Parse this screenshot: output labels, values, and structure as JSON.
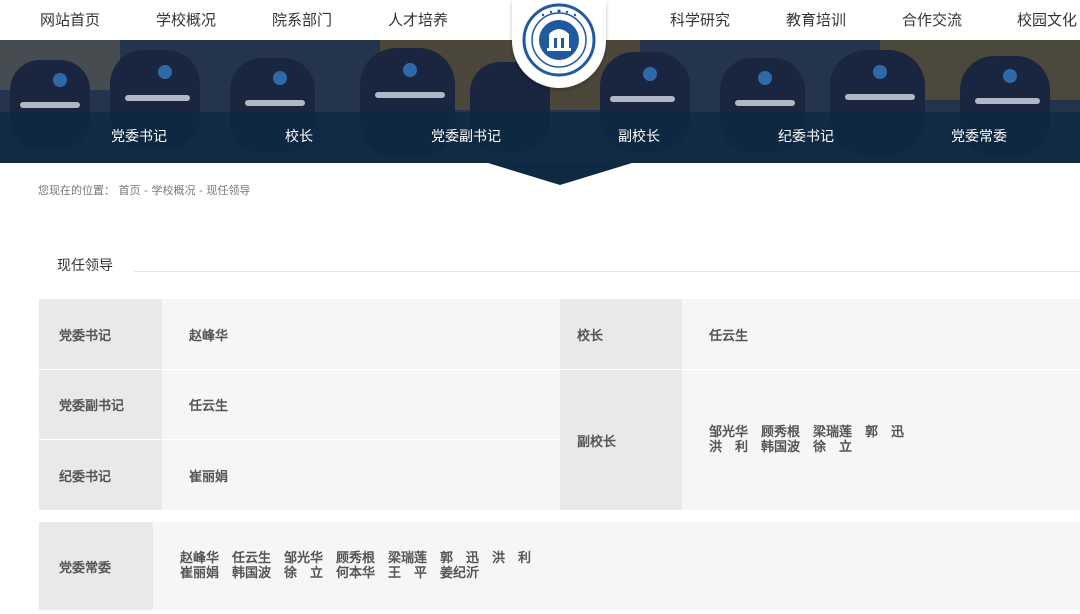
{
  "topnav": {
    "items": [
      "网站首页",
      "学校概况",
      "院系部门",
      "人才培养",
      "科学研究",
      "教育培训",
      "合作交流",
      "校园文化"
    ]
  },
  "subnav": {
    "items": [
      "党委书记",
      "校长",
      "党委副书记",
      "副校长",
      "纪委书记",
      "党委常委"
    ]
  },
  "breadcrumb": {
    "prefix": "您现在的位置：",
    "path": "首页 - 学校概况 - 现任领导"
  },
  "section": {
    "title": "现任领导"
  },
  "leaders": {
    "party_secretary": {
      "label": "党委书记",
      "name": "赵峰华"
    },
    "president": {
      "label": "校长",
      "name": "任云生"
    },
    "deputy_party_secretary": {
      "label": "党委副书记",
      "name": "任云生"
    },
    "discipline_secretary": {
      "label": "纪委书记",
      "name": "崔丽娟"
    },
    "vice_presidents": {
      "label": "副校长",
      "line1": "邹光华　顾秀根　梁瑞莲　郭　迅",
      "line2": "洪　利　韩国波　徐　立"
    },
    "standing_committee": {
      "label": "党委常委",
      "line1": "赵峰华　任云生　邹光华　顾秀根　梁瑞莲　郭　迅　洪　利",
      "line2": "崔丽娟　韩国波　徐　立　何本华　王　平　姜纪沂"
    }
  }
}
